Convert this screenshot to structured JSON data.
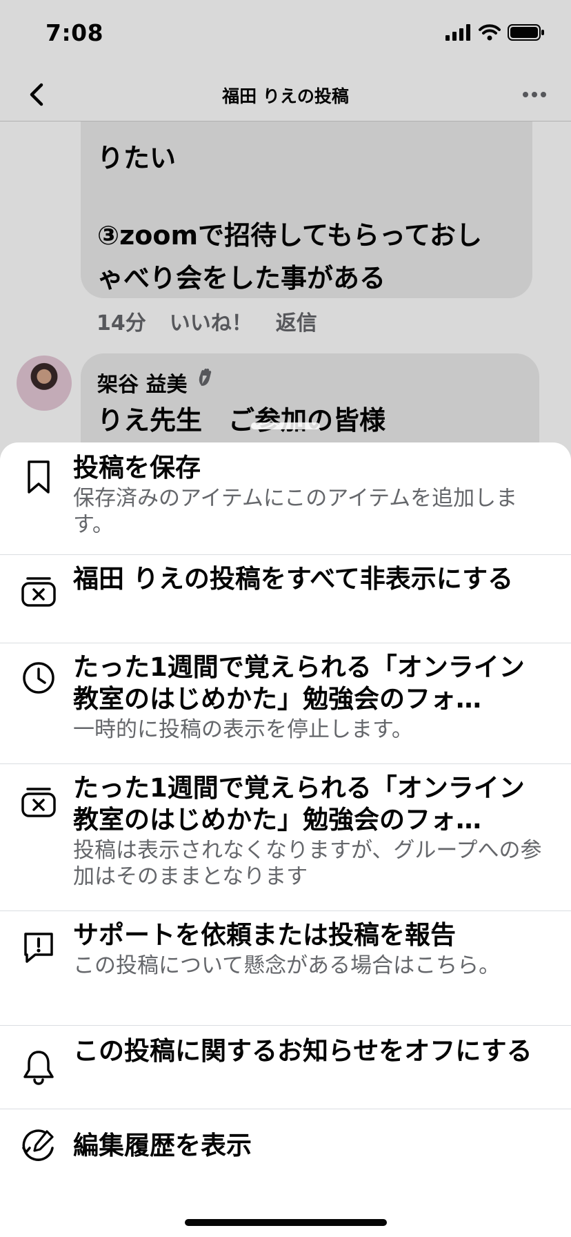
{
  "status_bar": {
    "time": "7:08"
  },
  "nav": {
    "title": "福田 りえの投稿"
  },
  "comment_1": {
    "lines": [
      "りたい",
      "③zoomで招待してもらっておし",
      "ゃべり会をした事がある"
    ],
    "time": "14分",
    "like": "いいね！",
    "reply": "返信"
  },
  "comment_2": {
    "author": "架谷 益美",
    "text": "りえ先生　ご参加の皆様"
  },
  "menu": [
    {
      "icon": "bookmark-icon",
      "title": "投稿を保存",
      "subtitle": "保存済みのアイテムにこのアイテムを追加します。"
    },
    {
      "icon": "hide-box-icon",
      "title": "福田 りえの投稿をすべて非表示にする",
      "subtitle": ""
    },
    {
      "icon": "clock-icon",
      "title": "たった1週間で覚えられる「オンライン教室のはじめかた」勉強会のフォ…",
      "subtitle": "一時的に投稿の表示を停止します。"
    },
    {
      "icon": "hide-box-icon",
      "title": "たった1週間で覚えられる「オンライン教室のはじめかた」勉強会のフォ…",
      "subtitle": "投稿は表示されなくなりますが、グループへの参加はそのままとなります"
    },
    {
      "icon": "report-icon",
      "title": "サポートを依頼または投稿を報告",
      "subtitle": "この投稿について懸念がある場合はこちら。"
    },
    {
      "icon": "bell-icon",
      "title": "この投稿に関するお知らせをオフにする",
      "subtitle": ""
    },
    {
      "icon": "edit-history-icon",
      "title": "編集履歴を表示",
      "subtitle": ""
    }
  ]
}
